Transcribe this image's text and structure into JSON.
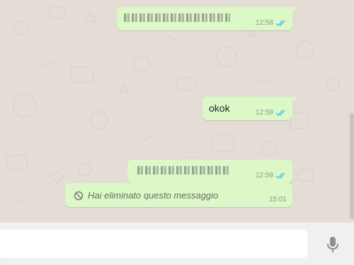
{
  "colors": {
    "chat_background": "#e4ddd6",
    "outgoing_bubble": "#dcf8c6",
    "read_ticks": "#4fc3f7",
    "footer": "#f0f0f0"
  },
  "messages": [
    {
      "text": "",
      "time": "12:58",
      "status": "read",
      "redacted": true
    },
    {
      "text": "okok",
      "time": "12:59",
      "status": "read",
      "redacted": false
    },
    {
      "text": "",
      "time": "12:59",
      "status": "read",
      "redacted": true
    },
    {
      "text": "Hai eliminato questo messaggio",
      "time": "15:01",
      "status": "deleted",
      "redacted": false
    }
  ],
  "composer": {
    "placeholder": "",
    "mic_icon": "microphone-icon"
  }
}
